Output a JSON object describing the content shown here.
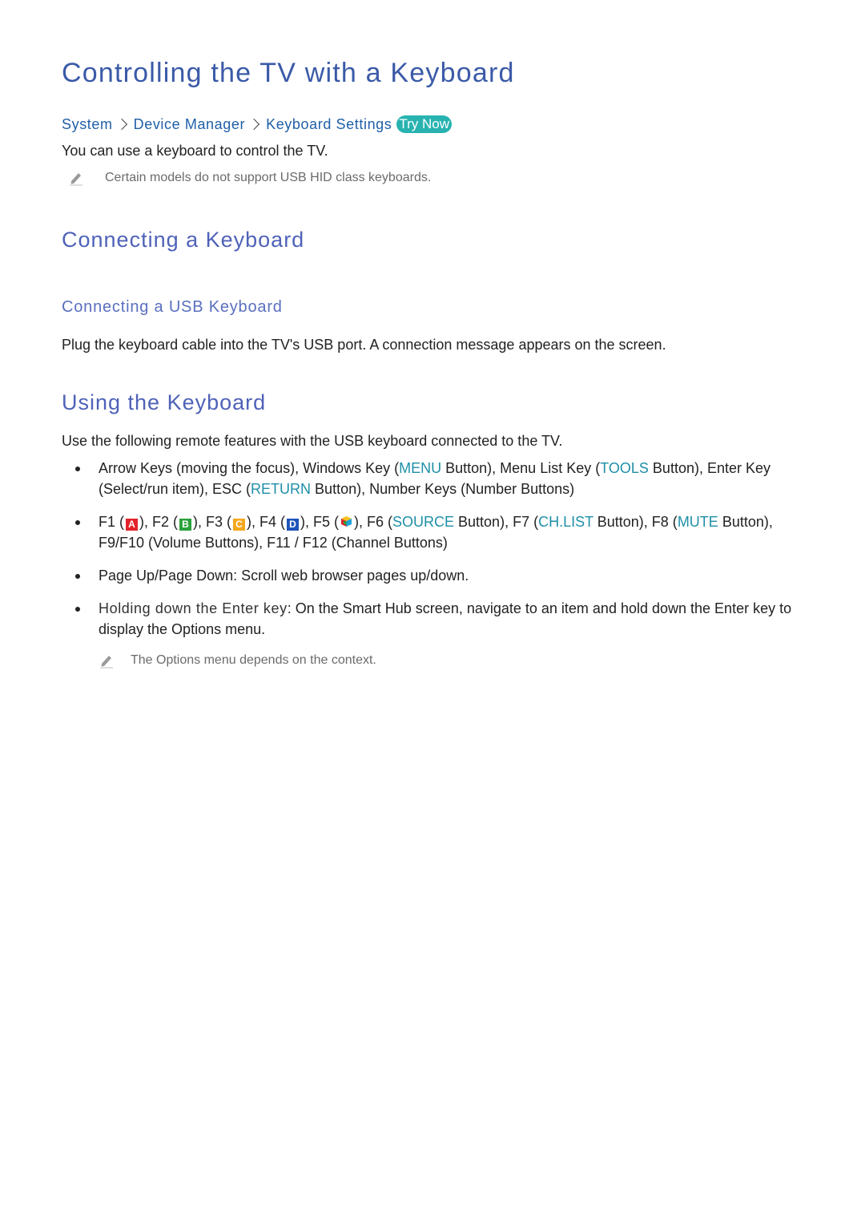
{
  "title": "Controlling the TV with a Keyboard",
  "breadcrumb": {
    "items": [
      "System",
      "Device Manager",
      "Keyboard Settings"
    ],
    "try_now": "Try Now"
  },
  "intro": "You can use a keyboard to control the TV.",
  "intro_note": "Certain models do not support USB HID class keyboards.",
  "sections": {
    "connecting": {
      "heading": "Connecting a Keyboard",
      "usb": {
        "heading": "Connecting a USB Keyboard",
        "text": "Plug the keyboard cable into the TV's USB port. A connection message appears on the screen."
      }
    },
    "using": {
      "heading": "Using the Keyboard",
      "intro": "Use the following remote features with the USB keyboard connected to the TV.",
      "bullet1": {
        "p1": "Arrow Keys (moving the focus), Windows Key (",
        "k1": "MENU",
        "p2": " Button), Menu List Key (",
        "k2": "TOOLS",
        "p3": " Button), Enter Key (Select/run item), ESC (",
        "k3": "RETURN",
        "p4": " Button), Number Keys (Number Buttons)"
      },
      "bullet2": {
        "f1": "F1 (",
        "key_a": "A",
        "f2": "), F2 (",
        "key_b": "B",
        "f3": "), F3 (",
        "key_c": "C",
        "f4": "), F4 (",
        "key_d": "D",
        "f5": "), F5 (",
        "f6": "), F6 (",
        "k_source": "SOURCE",
        "f7": " Button), F7 (",
        "k_chlist": "CH.LIST",
        "f8": " Button), F8 (",
        "k_mute": "MUTE",
        "rest": " Button), F9/F10 (Volume Buttons), F11 / F12 (Channel Buttons)"
      },
      "bullet3": "Page Up/Page Down: Scroll web browser pages up/down.",
      "bullet4": {
        "label": "Holding down the Enter key",
        "text": ": On the Smart Hub screen, navigate to an item and hold down the Enter key to display the Options menu."
      },
      "note": "The Options menu depends on the context."
    }
  },
  "colors": {
    "title": "#3a5aa8",
    "heading": "#4f62b8",
    "link": "#1f5fa8",
    "keyword": "#1e8fa8",
    "try_now_bg": "#28b3b0",
    "key_a": "#e3232b",
    "key_b": "#2aa23a",
    "key_c": "#f4a81c",
    "key_d": "#1f55b8"
  }
}
